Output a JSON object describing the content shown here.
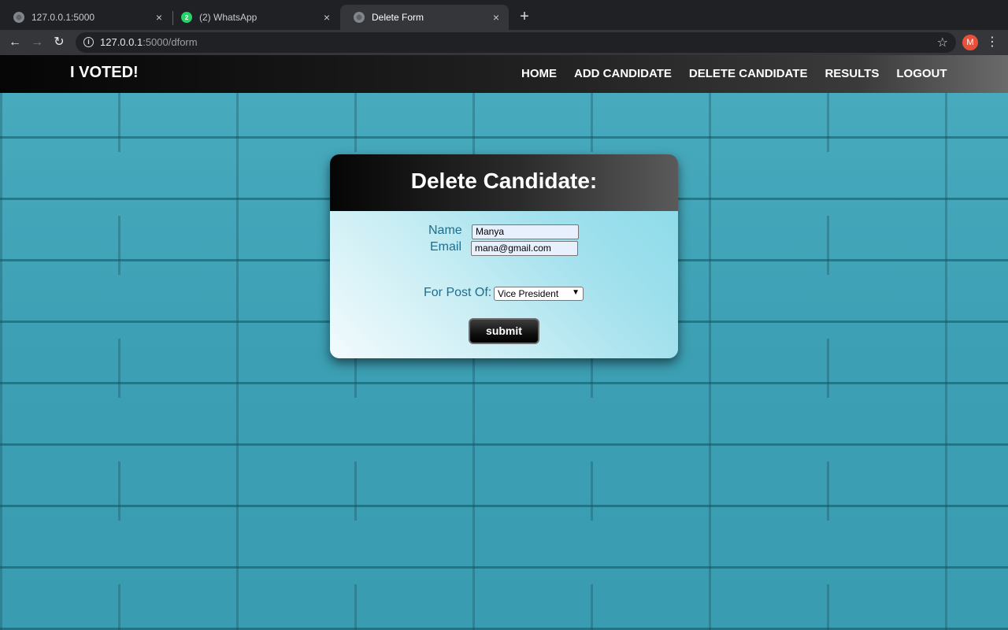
{
  "browser": {
    "tabs": [
      {
        "title": "127.0.0.1:5000",
        "icon": "globe-icon"
      },
      {
        "title": "(2) WhatsApp",
        "icon": "whatsapp-icon",
        "badge": "2"
      },
      {
        "title": "Delete Form",
        "icon": "globe-icon",
        "active": true
      }
    ],
    "new_tab_symbol": "+",
    "close_symbol": "×",
    "url_host": "127.0.0.1",
    "url_path": ":5000/dform",
    "profile_initial": "M",
    "menu_symbol": "⋮",
    "star_symbol": "☆",
    "back_symbol": "←",
    "forward_symbol": "→",
    "reload_symbol": "↻"
  },
  "navbar": {
    "brand": "I VOTED!",
    "links": [
      "HOME",
      "ADD CANDIDATE",
      "DELETE CANDIDATE",
      "RESULTS",
      "LOGOUT"
    ]
  },
  "form": {
    "title": "Delete Candidate:",
    "name_label": "Name",
    "name_value": "Manya",
    "email_label": "Email",
    "email_value": "mana@gmail.com",
    "post_label": "For Post Of:",
    "post_value": "Vice President",
    "submit_label": "submit"
  },
  "colors": {
    "wall": "#3fa3b6",
    "label_text": "#1f6d8c",
    "profile": "#e8503a"
  }
}
